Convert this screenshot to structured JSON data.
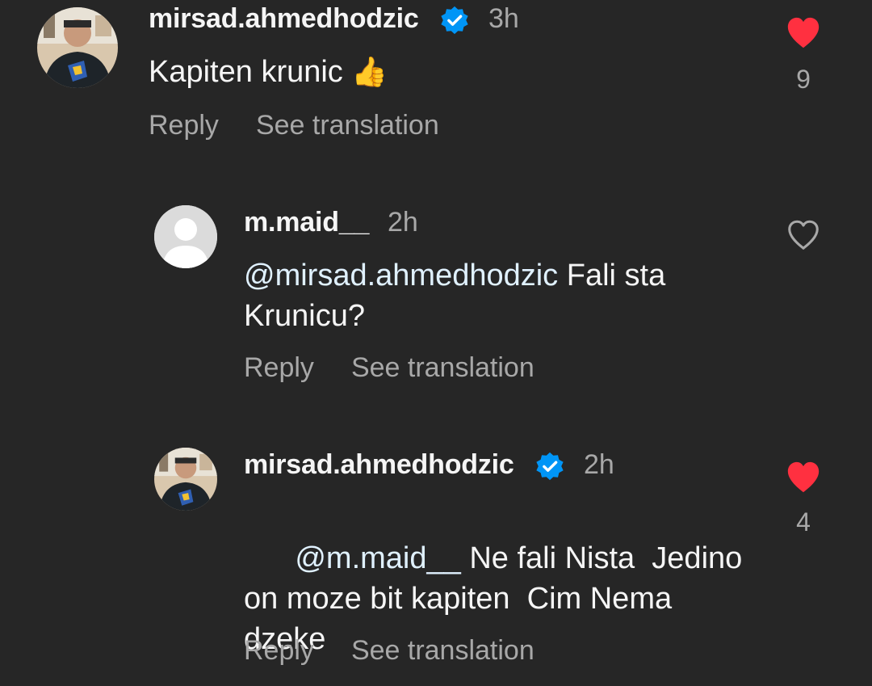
{
  "comments": [
    {
      "username": "mirsad.ahmedhodzic",
      "verified": true,
      "time": "3h",
      "mention": "",
      "text": "Kapiten krunic",
      "emoji": "👍",
      "liked": true,
      "likes": "9",
      "reply_label": "Reply",
      "translate_label": "See translation"
    },
    {
      "username": "m.maid__",
      "verified": false,
      "time": "2h",
      "mention": "@mirsad.ahmedhodzic",
      "text": "Fali sta Krunicu?",
      "liked": false,
      "likes": "",
      "reply_label": "Reply",
      "translate_label": "See translation"
    },
    {
      "username": "mirsad.ahmedhodzic",
      "verified": true,
      "time": "2h",
      "mention": "@m.maid__",
      "text": "Ne fali Nista  Jedino on moze bit kapiten  Cim Nema dzeke",
      "liked": true,
      "likes": "4",
      "reply_label": "Reply",
      "translate_label": "See translation"
    }
  ],
  "colors": {
    "background": "#262626",
    "like_red": "#ff3040",
    "verified_blue": "#0095f6",
    "muted": "#a8a8a8",
    "mention": "#e0f1ff"
  }
}
